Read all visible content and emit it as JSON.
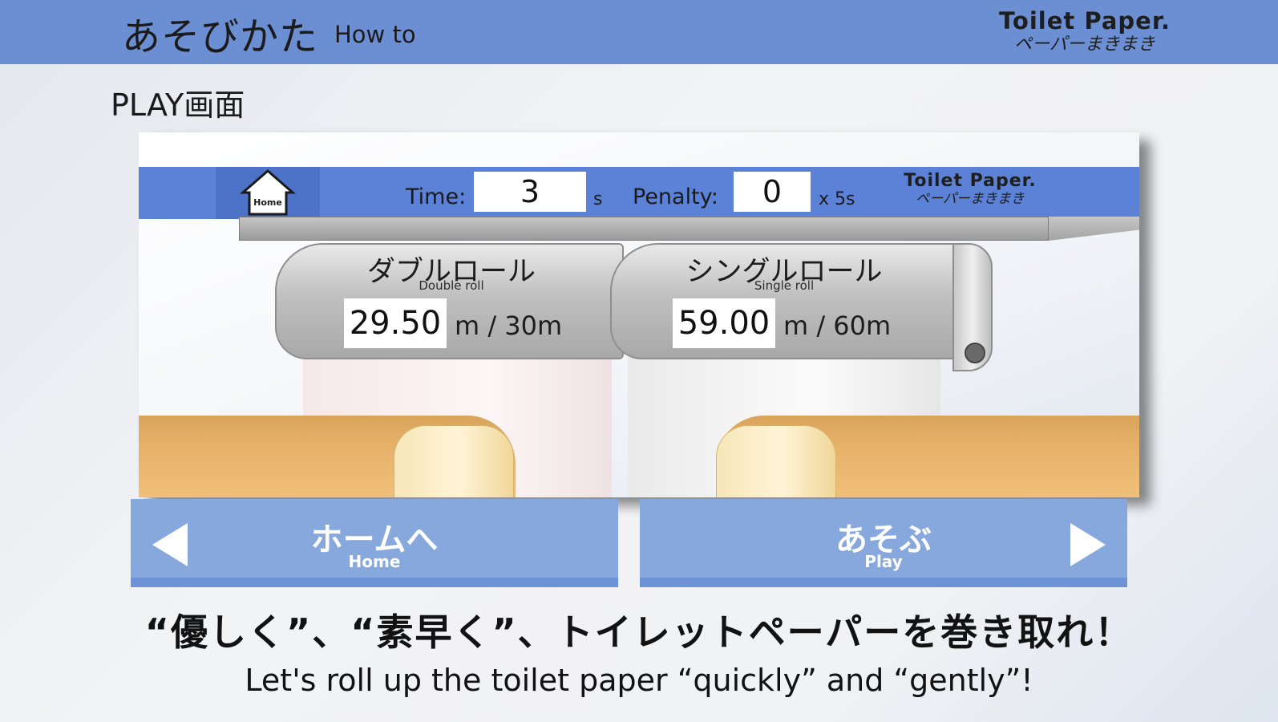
{
  "header": {
    "title": "あそびかた",
    "subtitle": "How to",
    "logo_line1": "Toilet Paper.",
    "logo_line2": "ペーパーまきまき"
  },
  "section_title": "PLAY画面",
  "preview": {
    "home_label": "Home",
    "time_label": "Time:",
    "time_value": "3",
    "time_unit": "s",
    "penalty_label": "Penalty:",
    "penalty_value": "0",
    "penalty_unit": "x 5s",
    "logo_line1": "Toilet Paper.",
    "logo_line2": "ペーパーまきまき",
    "double_roll": {
      "title": "ダブルロール",
      "subtitle": "Double roll",
      "value": "29.50",
      "unit": "m / 30m"
    },
    "single_roll": {
      "title": "シングルロール",
      "subtitle": "Single roll",
      "value": "59.00",
      "unit": "m / 60m"
    }
  },
  "buttons": {
    "home": {
      "label": "ホームへ",
      "sub": "Home"
    },
    "play": {
      "label": "あそぶ",
      "sub": "Play"
    }
  },
  "caption": {
    "jp": "“優しく”、“素早く”、トイレットペーパーを巻き取れ！",
    "en": "Let's roll up the toilet paper “quickly” and “gently”!"
  },
  "colors": {
    "header_bar": "#6b8fd2",
    "hud_bar": "#5b82d6",
    "button": "#87a8dd"
  }
}
